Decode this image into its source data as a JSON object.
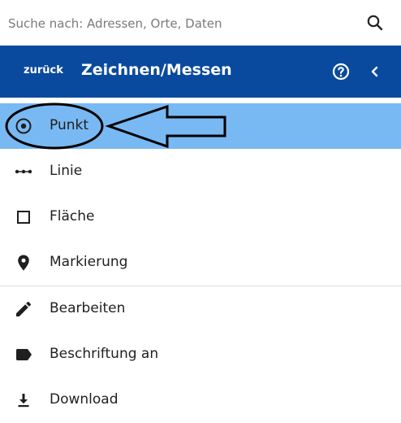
{
  "search": {
    "placeholder": "Suche nach: Adressen, Orte, Daten",
    "value": ""
  },
  "header": {
    "back_label": "zurück",
    "title": "Zeichnen/Messen"
  },
  "colors": {
    "header_bg": "#0a4a9e",
    "active_bg": "#79b9f3",
    "text": "#1f1f1f"
  },
  "menu": {
    "items": [
      {
        "label": "Punkt",
        "icon": "radio-point-icon",
        "active": true
      },
      {
        "label": "Linie",
        "icon": "polyline-icon"
      },
      {
        "label": "Fläche",
        "icon": "square-outline-icon"
      },
      {
        "label": "Markierung",
        "icon": "map-marker-icon"
      },
      {
        "label": "Bearbeiten",
        "icon": "pencil-icon"
      },
      {
        "label": "Beschriftung an",
        "icon": "label-tag-icon"
      },
      {
        "label": "Download",
        "icon": "download-icon"
      }
    ]
  }
}
